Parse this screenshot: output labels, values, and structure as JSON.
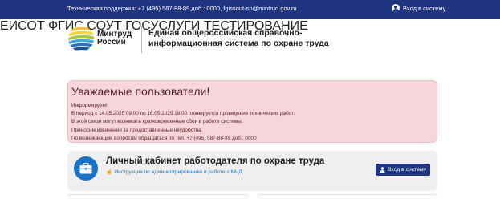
{
  "topbar": {
    "support_text": "Техническая поддержка: +7 (495) 587-88-89 доб.: 0000, fgissout-sp@mintrud.gov.ru",
    "login_label": "Вход в систему",
    "login_icon": "user-circle-icon"
  },
  "header": {
    "brand_line1": "Минтруд",
    "brand_line2": "России",
    "title_line1": "Единая общероссийская справочно-",
    "title_line2": "информационная система по охране труда",
    "nav": [
      "ЕИСОТ",
      "ФГИС СОУТ",
      "ГОСУСЛУГИ",
      "ТЕСТИРОВАНИЕ"
    ]
  },
  "alert": {
    "title": "Уважаемые  пользователи!",
    "lines": [
      "Информируем!",
      "В период с 14.05.2025 09:00 по 16.05.2025 18:00 планируется проведение технических работ.",
      "В этой связи могут возникать кратковременные сбои в работе системы.",
      "Приносим извинения за предоставленные неудобства.",
      "По возникающим вопросам обращаться по тел. +7 (495) 587-88-89 доб.: 0000"
    ]
  },
  "cabinet": {
    "title": "Личный кабинет работодателя по охране труда",
    "link": "Инструкция по администрированию и работе с МЧД",
    "button": "Вход в систему",
    "icon": "briefcase-icon",
    "link_icon": "hand-pointer-icon",
    "button_icon": "user-icon"
  },
  "colors": {
    "topbar": "#1f3580",
    "alert_bg": "#f6d6da",
    "accent": "#1a73c7"
  }
}
